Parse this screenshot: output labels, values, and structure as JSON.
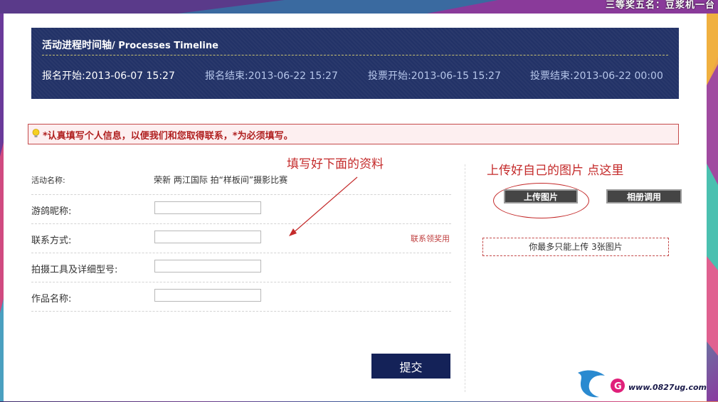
{
  "background_banner": "三等奖五名：豆浆机一台",
  "timeline": {
    "title_cn": "活动进程时间轴",
    "title_en": "/ Processes Timeline",
    "items": [
      {
        "label": "报名开始:2013-06-07 15:27"
      },
      {
        "label": "报名结束:2013-06-22 15:27"
      },
      {
        "label": "投票开始:2013-06-15 15:27"
      },
      {
        "label": "投票结束:2013-06-22 00:00"
      }
    ]
  },
  "notice": {
    "icon": "lightbulb-icon",
    "text": "*认真填写个人信息，以便我们和您取得联系，*为必须填写。"
  },
  "form": {
    "activity_name_label": "活动名称:",
    "activity_name_value": "荣新 两江国际 拍“样板间”摄影比赛",
    "nickname_label": "游鸽昵称:",
    "nickname_value": "",
    "contact_label": "联系方式:",
    "contact_value": "",
    "contact_hint": "联系领奖用",
    "equipment_label": "拍摄工具及详细型号:",
    "equipment_value": "",
    "work_name_label": "作品名称:",
    "work_name_value": "",
    "submit_label": "提交"
  },
  "upload": {
    "upload_button_label": "上传图片",
    "album_button_label": "相册调用",
    "limit_text": "你最多只能上传 3张图片"
  },
  "annotations": {
    "left": "填写好下面的资料",
    "right": "上传好自己的图片  点这里",
    "color": "#c42a2a"
  },
  "logo": {
    "letter": "G",
    "text": "www.0827ug.com"
  },
  "colors": {
    "timeline_bg": "#223267",
    "submit_bg": "#142258",
    "notice_border": "#c44a4a",
    "notice_text": "#b02020"
  }
}
